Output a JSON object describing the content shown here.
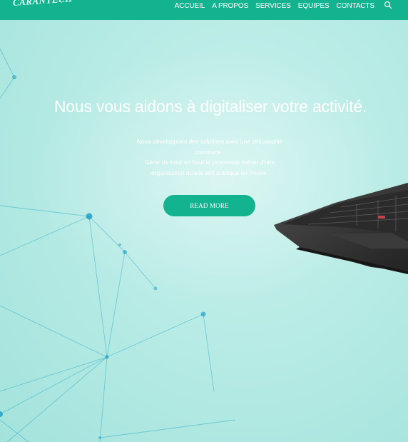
{
  "brand": {
    "logo_text": "CARANTECH"
  },
  "nav": {
    "items": [
      "ACCUEIL",
      "A PROPOS",
      "SERVICES",
      "EQUIPES",
      "CONTACTS"
    ],
    "search_icon": "search-icon"
  },
  "hero": {
    "headline": "Nous vous aidons à digitaliser votre activité.",
    "description_lines": [
      "Nous développons des solutions avec une philosophie",
      "commune :",
      "Gérer de bout en bout le processus métier d'une",
      "organisation qu'elle soit publique ou Privée."
    ],
    "cta_label": "READ MORE"
  },
  "colors": {
    "brand_green": "#13b38f",
    "hero_bg": "#bfece6",
    "network_blue": "#1aa4c8"
  }
}
